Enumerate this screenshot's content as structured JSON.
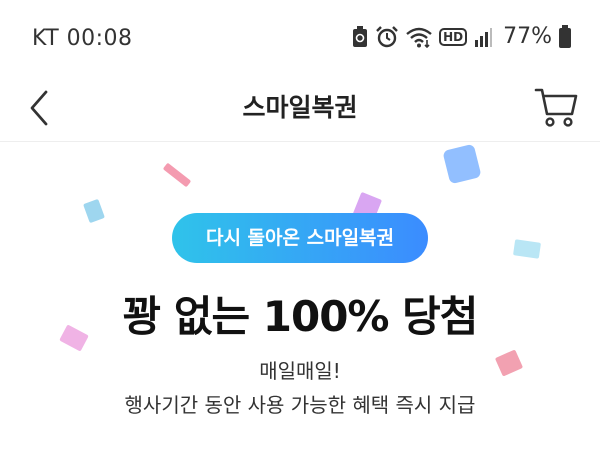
{
  "status_bar": {
    "carrier_time": "KT 00:08",
    "icons": [
      "battery-saver-icon",
      "alarm-icon",
      "wifi-icon",
      "hd-voice-icon",
      "signal-icon",
      "battery-icon"
    ],
    "hd_label": "HD",
    "battery_percent": "77%"
  },
  "nav": {
    "back_icon": "chevron-left-icon",
    "title": "스마일복권",
    "cart_icon": "cart-icon"
  },
  "promo": {
    "pill_label": "다시 돌아온 스마일복권",
    "headline": "꽝 없는 100% 당첨",
    "subtitle_line1": "매일매일!",
    "subtitle_line2": "행사기간 동안 사용 가능한 혜택 즉시 지급",
    "colors": {
      "pill_start": "#2fc3ea",
      "pill_end": "#3b8cff",
      "confetti": [
        "#f49bb0",
        "#9ed6ef",
        "#d9a6f2",
        "#7fb4ff",
        "#b9e6f5",
        "#f0b3e5",
        "#f2a1b1"
      ]
    }
  }
}
